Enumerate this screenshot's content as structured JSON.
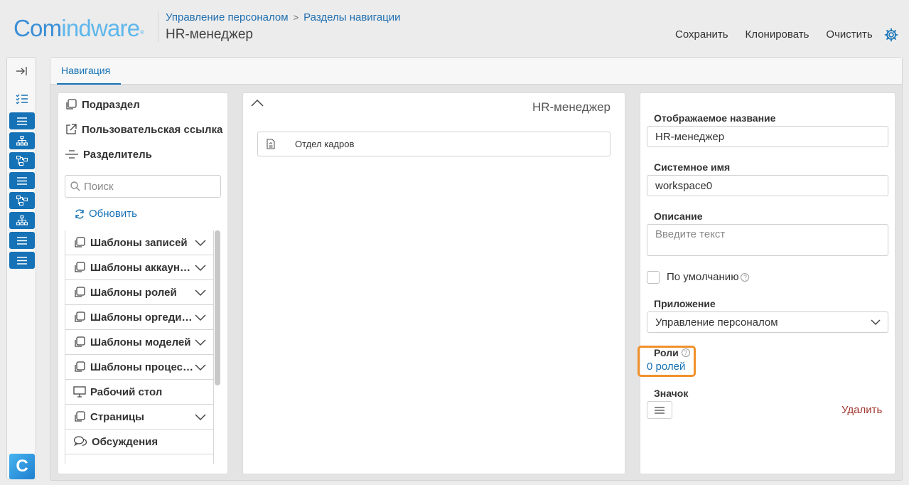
{
  "header": {
    "logo_part1": "Com",
    "logo_part2": "indware",
    "logo_mark": "®",
    "breadcrumb": [
      "Управление персоналом",
      "Разделы навигации"
    ],
    "breadcrumb_sep": ">",
    "title": "HR-менеджер",
    "actions": {
      "save": "Сохранить",
      "clone": "Клонировать",
      "clear": "Очистить"
    }
  },
  "rail": {
    "logo_letter": "C",
    "buttons": [
      "list-icon",
      "hierarchy-icon",
      "process-icon",
      "list-icon",
      "process-icon",
      "hierarchy-icon",
      "list-icon",
      "list-icon"
    ]
  },
  "tabs": {
    "navigation": "Навигация"
  },
  "left_panel": {
    "tools": {
      "subsection": "Подраздел",
      "custom_link": "Пользовательская ссылка",
      "separator": "Разделитель"
    },
    "search_placeholder": "Поиск",
    "refresh": "Обновить",
    "tree": [
      {
        "label": "Шаблоны записей",
        "expandable": true
      },
      {
        "label": "Шаблоны аккаунтов",
        "expandable": true
      },
      {
        "label": "Шаблоны ролей",
        "expandable": true
      },
      {
        "label": "Шаблоны оргединиц",
        "expandable": true
      },
      {
        "label": "Шаблоны моделей",
        "expandable": true
      },
      {
        "label": "Шаблоны процессов",
        "expandable": true
      },
      {
        "label": "Рабочий стол",
        "expandable": false
      },
      {
        "label": "Страницы",
        "expandable": true
      },
      {
        "label": "Обсуждения",
        "expandable": false
      }
    ]
  },
  "middle_panel": {
    "title": "HR-менеджер",
    "items": [
      "Отдел кадров"
    ]
  },
  "right_panel": {
    "display_name_label": "Отображаемое название",
    "display_name_value": "HR-менеджер",
    "system_name_label": "Системное имя",
    "system_name_value": "workspace0",
    "description_label": "Описание",
    "description_placeholder": "Введите текст",
    "default_label": "По умолчанию",
    "default_checked": false,
    "app_label": "Приложение",
    "app_value": "Управление персоналом",
    "roles_label": "Роли",
    "roles_link": "0 ролей",
    "icon_label": "Значок",
    "delete": "Удалить",
    "highlight_color": "#f0912b"
  },
  "colors": {
    "accent": "#1572b6",
    "danger": "#a0342d"
  }
}
